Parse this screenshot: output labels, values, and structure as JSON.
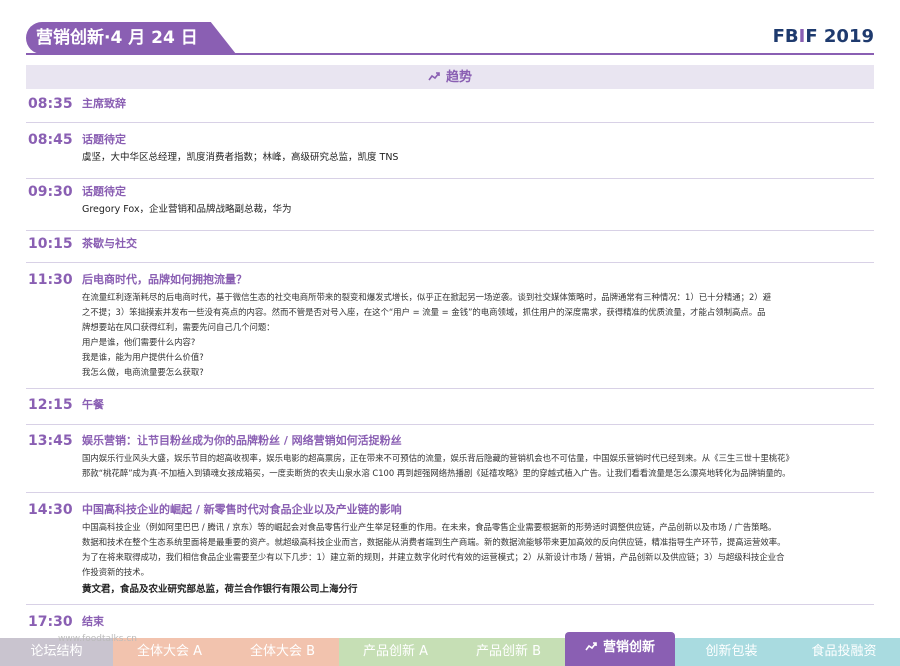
{
  "header": {
    "title": "营销创新·4 月 24 日",
    "logo_part1": "FB",
    "logo_part2": "I",
    "logo_part3": "F 2019"
  },
  "section": {
    "icon": "trend-icon",
    "label": "趋势"
  },
  "schedule": [
    {
      "time": "08:35",
      "topic": "主席致辞",
      "desc": [],
      "speakers": []
    },
    {
      "time": "08:45",
      "topic": "话题待定",
      "desc": [],
      "speakers": [
        "虞坚，大中华区总经理，凯度消费者指数；林峰，高级研究总监，凯度 TNS"
      ]
    },
    {
      "time": "09:30",
      "topic": "话题待定",
      "desc": [],
      "speakers": [
        "Gregory Fox，企业营销和品牌战略副总裁，华为"
      ]
    },
    {
      "time": "10:15",
      "topic": "茶歇与社交",
      "desc": [],
      "speakers": []
    },
    {
      "time": "11:30",
      "topic": "后电商时代，品牌如何拥抱流量？",
      "desc": [
        "在流量红利逐渐耗尽的后电商时代，基于微信生态的社交电商所带来的裂变和爆发式增长，似乎正在掀起另一场逆袭。谈到社交媒体策略时，品牌通常有三种情况：1）已十分精通；2）避",
        "之不提；3）笨拙摸索并发布一些没有亮点的内容。然而不管是否对号入座，在这个“用户 = 流量 = 金钱”的电商领域，抓住用户的深度需求，获得精准的优质流量，才能占领制高点。品",
        "牌想要站在风口获得红利，需要先问自己几个问题：",
        "用户是谁，他们需要什么内容?",
        "我是谁，能为用户提供什么价值?",
        "我怎么做，电商流量要怎么获取?"
      ],
      "speakers": []
    },
    {
      "time": "12:15",
      "topic": "午餐",
      "desc": [],
      "speakers": []
    },
    {
      "time": "13:45",
      "topic": "娱乐营销：让节目粉丝成为你的品牌粉丝 / 网络营销如何活捉粉丝",
      "desc": [
        "国内娱乐行业风头大盛，娱乐节目的超高收视率，娱乐电影的超高票房，正在带来不可预估的流量，娱乐背后隐藏的营销机会也不可估量，中国娱乐营销时代已经到来。从《三生三世十里桃花》",
        "那款“桃花醉”成为真·不加植入到镇魂女孩成箱买，一度卖断货的农夫山泉水溶 C100 再到超强网络热播剧《延禧攻略》里的穿越式植入广告。让我们看看流量是怎么漂亮地转化为品牌销量的。"
      ],
      "speakers": []
    },
    {
      "time": "14:30",
      "topic": "中国高科技企业的崛起 / 新零售时代对食品企业以及产业链的影响",
      "desc": [
        "中国高科技企业（例如阿里巴巴 / 腾讯 / 京东）等的崛起会对食品零售行业产生举足轻重的作用。在未来，食品零售企业需要根据新的形势适时调整供应链，产品创新以及市场 / 广告策略。",
        "数据和技术在整个生态系统里面将是最重要的资产。就超级高科技企业而言，数据能从消费者端到生产商端。新的数据流能够带来更加高效的反向供应链，精准指导生产环节，提高运营效率。",
        "为了在将来取得成功，我们相信食品企业需要至少有以下几步：1）建立新的规则，并建立数字化时代有效的运营模式；2）从新设计市场 / 营销，产品创新以及供应链；3）与超级科技企业合",
        "作投资新的技术。"
      ],
      "speakers": [
        "黄文君，食品及农业研究部总监，荷兰合作银行有限公司上海分行"
      ]
    },
    {
      "time": "17:30",
      "topic": "结束",
      "desc": [],
      "speakers": []
    }
  ],
  "footer": {
    "watermark": "www.foodtalks.cn",
    "nav": [
      {
        "label": "论坛结构",
        "color": "#c9c4cf"
      },
      {
        "label": "全体大会 A",
        "color": "#f2c3ae"
      },
      {
        "label": "全体大会 B",
        "color": "#f2c3ae"
      },
      {
        "label": "产品创新 A",
        "color": "#c6dfb5"
      },
      {
        "label": "产品创新 B",
        "color": "#c6dfb5"
      },
      {
        "label": "营销创新",
        "color": "#8a5fb3",
        "icon": "trend-icon"
      },
      {
        "label": "创新包装",
        "color": "#a9dbe0"
      },
      {
        "label": "食品投融资",
        "color": "#a9dbe0"
      }
    ]
  },
  "colors": {
    "accent": "#8a5fb3",
    "band": "#e9e5f1",
    "logo_blue": "#1e3a6e"
  }
}
